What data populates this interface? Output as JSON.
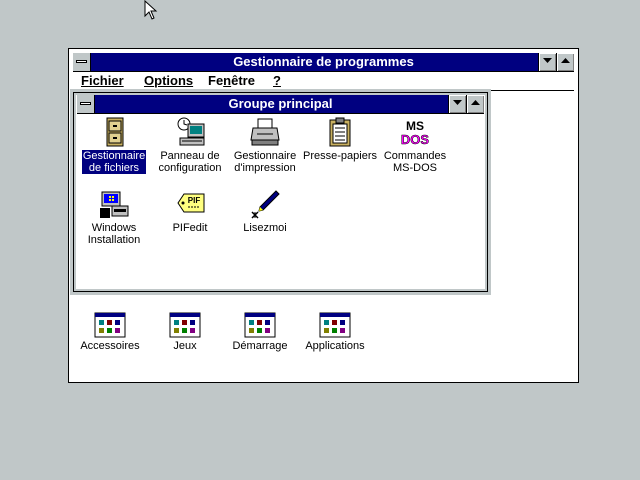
{
  "program_manager": {
    "title": "Gestionnaire de programmes",
    "menu": [
      {
        "accel": "F",
        "rest": "ichier"
      },
      {
        "accel": "O",
        "rest": "ptions"
      },
      {
        "pre": "Fe",
        "accel": "n",
        "rest": "être"
      },
      {
        "accel": "?",
        "rest": ""
      }
    ]
  },
  "main_group": {
    "title": "Groupe principal",
    "icons": [
      {
        "line1": "Gestionnaire",
        "line2": "de fichiers",
        "icon": "file-cabinet-icon",
        "selected": true
      },
      {
        "line1": "Panneau de",
        "line2": "configuration",
        "icon": "control-panel-icon"
      },
      {
        "line1": "Gestionnaire",
        "line2": "d'impression",
        "icon": "printer-icon"
      },
      {
        "line1": "Presse-papiers",
        "line2": "",
        "icon": "clipboard-icon"
      },
      {
        "line1": "Commandes",
        "line2": "MS-DOS",
        "icon": "msdos-icon",
        "icon_text": "MS DOS"
      },
      {
        "line1": "Windows",
        "line2": "Installation",
        "icon": "setup-icon"
      },
      {
        "line1": "PIFedit",
        "line2": "",
        "icon": "pif-editor-icon",
        "icon_text": "PIF"
      },
      {
        "line1": "Lisezmoi",
        "line2": "",
        "icon": "readme-pen-icon"
      }
    ]
  },
  "minimized_groups": [
    {
      "label": "Accessoires",
      "icon": "group-icon"
    },
    {
      "label": "Jeux",
      "icon": "group-icon"
    },
    {
      "label": "Démarrage",
      "icon": "group-icon"
    },
    {
      "label": "Applications",
      "icon": "group-icon"
    }
  ],
  "colors": {
    "desktop": "#c0c7c8",
    "titlebar_active": "#000080",
    "selection": "#000080"
  }
}
